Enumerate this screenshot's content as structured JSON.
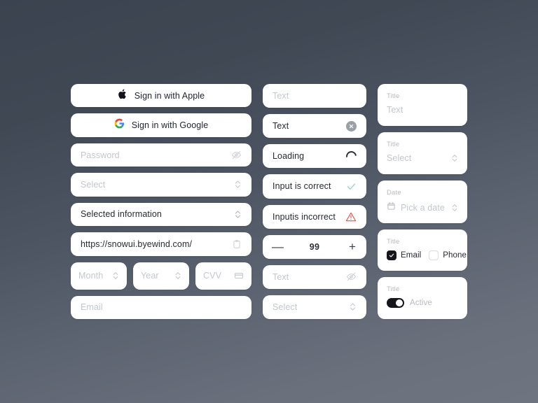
{
  "background": {
    "from": "#3b4350",
    "to": "#6e7480"
  },
  "left_column": {
    "apple_button": {
      "label": "Sign in with Apple",
      "icon": "apple-logo-icon"
    },
    "google_button": {
      "label": "Sign in with Google",
      "icon": "google-logo-icon"
    },
    "password_field": {
      "placeholder": "Password",
      "value": "",
      "icon": "eye-off-icon"
    },
    "select_empty": {
      "placeholder": "Select",
      "value": "",
      "icon": "chevron-updown-icon"
    },
    "select_filled": {
      "value": "Selected information",
      "icon": "chevron-updown-icon"
    },
    "url_field": {
      "value": "https://snowui.byewind.com/",
      "icon": "clipboard-icon"
    },
    "card_row": [
      {
        "placeholder": "Month",
        "icon": "chevron-updown-icon"
      },
      {
        "placeholder": "Year",
        "icon": "chevron-updown-icon"
      },
      {
        "placeholder": "CVV",
        "icon": "credit-card-icon"
      }
    ],
    "email_field": {
      "placeholder": "Email",
      "value": ""
    }
  },
  "middle_column": {
    "text_empty": {
      "placeholder": "Text",
      "value": ""
    },
    "text_clearable": {
      "value": "Text",
      "icon": "clear-circle-icon"
    },
    "loading": {
      "value": "Loading",
      "icon": "spinner-icon"
    },
    "valid": {
      "value": "Input is correct",
      "icon": "check-icon",
      "color": "#8fd0bd"
    },
    "invalid": {
      "value": "Inputis incorrect",
      "icon": "warning-triangle-icon",
      "color": "#ef4b44"
    },
    "stepper": {
      "minus": "—",
      "value": "99",
      "plus": "+"
    },
    "text_hidden": {
      "placeholder": "Text",
      "value": "",
      "icon": "eye-off-icon"
    },
    "select_disabled": {
      "placeholder": "Select",
      "value": "",
      "icon": "chevron-updown-icon"
    }
  },
  "right_column": {
    "text_card": {
      "title": "Title",
      "placeholder": "Text"
    },
    "select_card": {
      "title": "Title",
      "placeholder": "Select",
      "icon": "chevron-updown-icon"
    },
    "date_card": {
      "title": "Date",
      "placeholder": "Pick a date",
      "icon": "calendar-icon",
      "trailing_icon": "chevron-updown-icon"
    },
    "choice_card": {
      "title": "Title",
      "options": [
        {
          "label": "Email",
          "checked": true
        },
        {
          "label": "Phone",
          "checked": false
        }
      ]
    },
    "toggle_card": {
      "title": "Title",
      "label": "Active",
      "enabled": true
    }
  }
}
